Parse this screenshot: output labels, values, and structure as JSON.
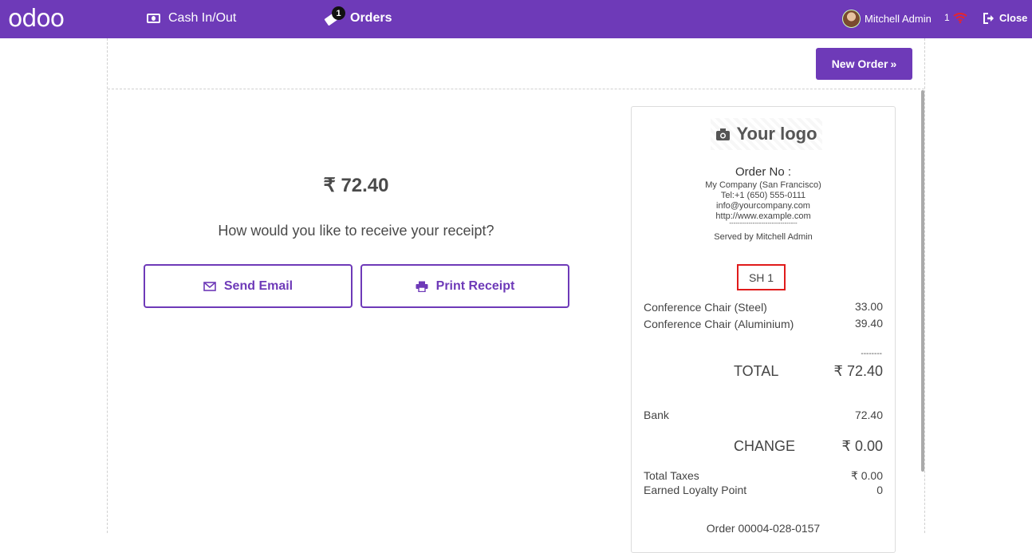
{
  "topbar": {
    "logo": "odoo",
    "cash_label": "Cash In/Out",
    "orders_label": "Orders",
    "orders_badge": "1",
    "user_name": "Mitchell Admin",
    "net_count": "1",
    "close_label": "Close"
  },
  "actions": {
    "new_order_label": "New Order"
  },
  "payment": {
    "amount": "₹ 72.40",
    "question": "How would you like to receive your receipt?",
    "send_email_label": "Send Email",
    "print_receipt_label": "Print Receipt"
  },
  "receipt": {
    "logo_text": "Your logo",
    "order_no_label": "Order No :",
    "company": "My Company (San Francisco)",
    "phone": "Tel:+1 (650) 555-0111",
    "email": "info@yourcompany.com",
    "website": "http://www.example.com",
    "separator": "--------------------------------",
    "served_by": "Served by Mitchell Admin",
    "table": "SH 1",
    "lines": [
      {
        "name": "Conference Chair (Steel)",
        "price": "33.00"
      },
      {
        "name": "Conference Chair (Aluminium)",
        "price": "39.40"
      }
    ],
    "total_dashes": "--------",
    "total_label": "TOTAL",
    "total_value": "₹ 72.40",
    "payment_method": "Bank",
    "payment_amount": "72.40",
    "change_label": "CHANGE",
    "change_value": "₹ 0.00",
    "taxes_label": "Total Taxes",
    "taxes_value": "₹ 0.00",
    "loyalty_label": "Earned Loyalty Point",
    "loyalty_value": "0",
    "order_ref": "Order 00004-028-0157"
  },
  "colors": {
    "brand": "#6e3ab8",
    "highlight": "#e01b1b"
  },
  "icons": [
    "cash-icon",
    "ticket-icon",
    "wifi-icon",
    "exit-icon",
    "envelope-icon",
    "printer-icon",
    "camera-icon",
    "double-chevron-right-icon"
  ]
}
